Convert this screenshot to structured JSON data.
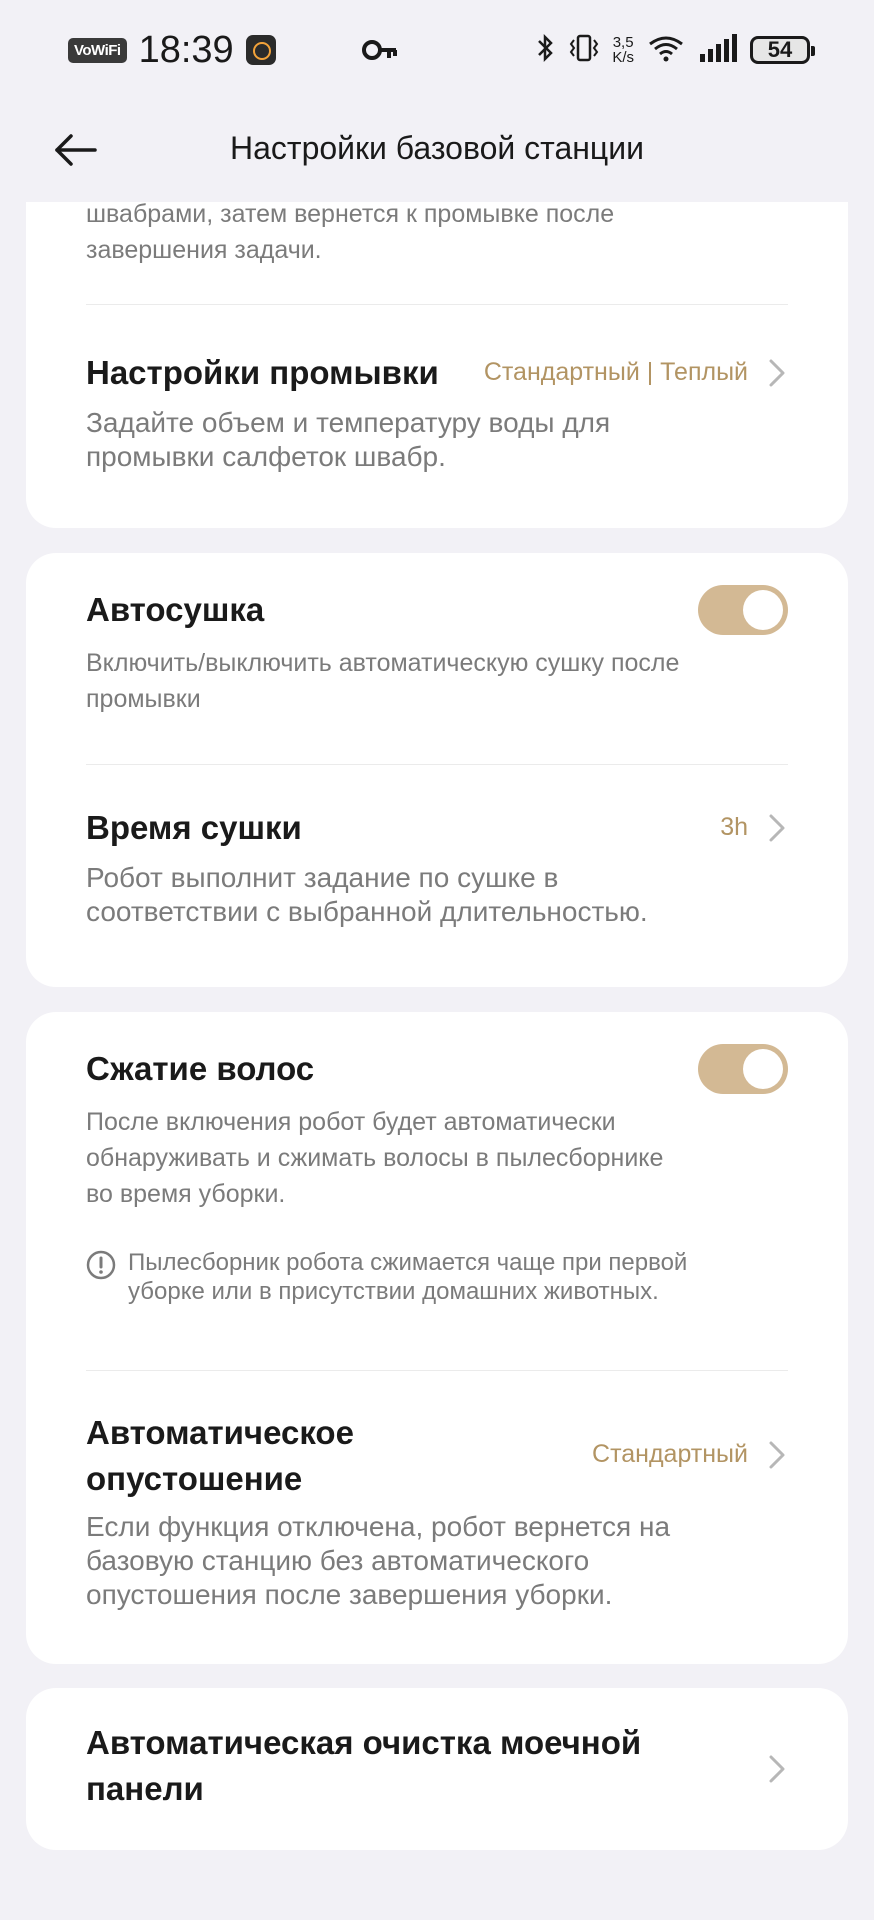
{
  "status_bar": {
    "vowifi": "VoWiFi",
    "time": "18:39",
    "speed_value": "3,5",
    "speed_unit": "K/s",
    "battery": "54"
  },
  "header": {
    "title": "Настройки базовой станции"
  },
  "card1": {
    "partial_desc_line1": "швабрами, затем вернется к промывке после",
    "partial_desc_line2": "завершения задачи.",
    "wash": {
      "title": "Настройки промывки",
      "value": "Стандартный | Теплый",
      "desc": "Задайте объем и температуру воды для промывки салфеток швабр."
    }
  },
  "card2": {
    "auto_dry": {
      "title": "Автосушка",
      "desc": "Включить/выключить автоматическую сушку после промывки",
      "enabled": true
    },
    "dry_time": {
      "title": "Время сушки",
      "value": "3h",
      "desc": "Робот выполнит задание по сушке в соответствии с выбранной длительностью."
    }
  },
  "card3": {
    "hair": {
      "title": "Сжатие волос",
      "desc": "После включения робот будет автоматически обнаруживать и сжимать волосы в пылесборнике во время уборки.",
      "enabled": true,
      "note": "Пылесборник робота сжимается чаще при первой уборке или в присутствии домашних животных."
    },
    "auto_empty": {
      "title": "Автоматическое опустошение",
      "value": "Стандартный",
      "desc": "Если функция отключена, робот вернется на базовую станцию без автоматического опустошения после завершения уборки."
    }
  },
  "card4": {
    "wash_panel": {
      "title": "Автоматическая очистка моечной панели"
    }
  },
  "colors": {
    "accent": "#b29463",
    "toggle_on": "#d3b994",
    "background": "#f2f1f6"
  }
}
